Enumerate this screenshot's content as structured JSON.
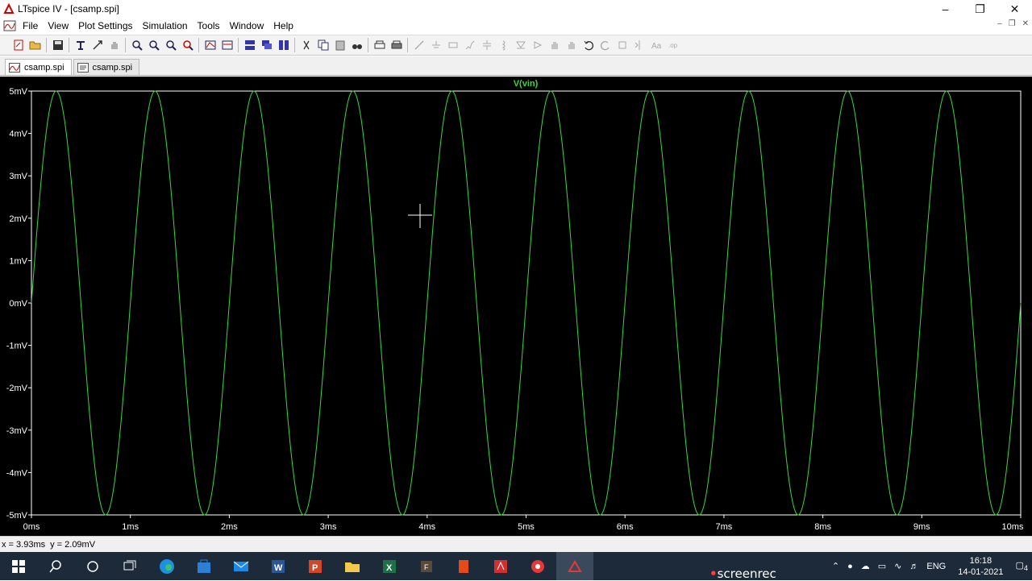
{
  "window": {
    "title": "LTspice IV - [csamp.spi]"
  },
  "menu": [
    "File",
    "View",
    "Plot Settings",
    "Simulation",
    "Tools",
    "Window",
    "Help"
  ],
  "tabs": [
    {
      "label": "csamp.spi",
      "active": true
    },
    {
      "label": "csamp.spi",
      "active": false
    }
  ],
  "status": {
    "x_readout": "x = 3.93ms",
    "y_readout": "y = 2.09mV"
  },
  "taskbar": {
    "lang": "ENG",
    "time": "16:18",
    "date": "14-01-2021",
    "notifications": "4",
    "watermark": "screenrec"
  },
  "colors": {
    "trace": "#33dd33",
    "plot_bg": "#000000",
    "axis_text": "#ffffff"
  },
  "chart_data": {
    "type": "line",
    "title": "V(vin)",
    "xlabel": "",
    "ylabel": "",
    "xlim": [
      0,
      10
    ],
    "ylim": [
      -5,
      5
    ],
    "x_ticks": [
      "0ms",
      "1ms",
      "2ms",
      "3ms",
      "4ms",
      "5ms",
      "6ms",
      "7ms",
      "8ms",
      "9ms",
      "10ms"
    ],
    "y_ticks": [
      "5mV",
      "4mV",
      "3mV",
      "2mV",
      "1mV",
      "0mV",
      "-1mV",
      "-2mV",
      "-3mV",
      "-4mV",
      "-5mV"
    ],
    "series": [
      {
        "name": "V(vin)",
        "function": "sine",
        "amplitude_mV": 5,
        "frequency_kHz": 1,
        "offset_mV": 0,
        "phase_deg": 0
      }
    ],
    "grid": false
  }
}
